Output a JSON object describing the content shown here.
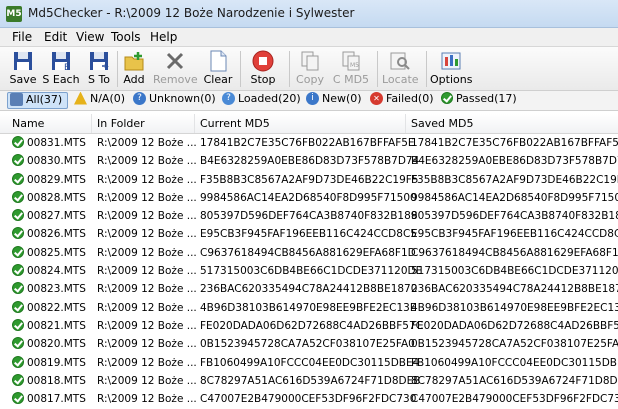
{
  "window": {
    "title": "Md5Checker - R:\\2009 12 Boże Narodzenie i Sylwester"
  },
  "menu": [
    "File",
    "Edit",
    "View",
    "Tools",
    "Help"
  ],
  "toolbar": {
    "save": "Save",
    "s_each": "S Each",
    "s_to": "S To",
    "add": "Add",
    "remove": "Remove",
    "clear": "Clear",
    "stop": "Stop",
    "copy": "Copy",
    "c_md5": "C MD5",
    "locate": "Locate",
    "options": "Options"
  },
  "filters": {
    "all": "All(37)",
    "na": "N/A(0)",
    "unknown": "Unknown(0)",
    "loaded": "Loaded(20)",
    "new": "New(0)",
    "failed": "Failed(0)",
    "passed": "Passed(17)"
  },
  "columns": {
    "name": "Name",
    "folder": "In Folder",
    "current": "Current MD5",
    "saved": "Saved MD5"
  },
  "rows": [
    {
      "name": "00831.MTS",
      "folder": "R:\\2009 12 Boże ...",
      "current": "17841B2C7E35C76FB022AB167BFFAF5E",
      "saved": "17841B2C7E35C76FB022AB167BFFAF5E"
    },
    {
      "name": "00830.MTS",
      "folder": "R:\\2009 12 Boże ...",
      "current": "B4E6328259A0EBE86D83D73F578B7D74",
      "saved": "B4E6328259A0EBE86D83D73F578B7D74"
    },
    {
      "name": "00829.MTS",
      "folder": "R:\\2009 12 Boże ...",
      "current": "F35B8B3C8567A2AF9D73DE46B22C19F5",
      "saved": "F35B8B3C8567A2AF9D73DE46B22C19F5"
    },
    {
      "name": "00828.MTS",
      "folder": "R:\\2009 12 Boże ...",
      "current": "9984586AC14EA2D68540F8D995F71500",
      "saved": "9984586AC14EA2D68540F8D995F71500"
    },
    {
      "name": "00827.MTS",
      "folder": "R:\\2009 12 Boże ...",
      "current": "805397D596DEF764CA3B8740F832B189",
      "saved": "805397D596DEF764CA3B8740F832B189"
    },
    {
      "name": "00826.MTS",
      "folder": "R:\\2009 12 Boże ...",
      "current": "E95CB3F945FAF196EEB116C424CCD8C5",
      "saved": "E95CB3F945FAF196EEB116C424CCD8C5"
    },
    {
      "name": "00825.MTS",
      "folder": "R:\\2009 12 Boże ...",
      "current": "C9637618494CB8456A881629EFA68F1D",
      "saved": "C9637618494CB8456A881629EFA68F1D"
    },
    {
      "name": "00824.MTS",
      "folder": "R:\\2009 12 Boże ...",
      "current": "517315003C6DB4BE66C1DCDE371120DE",
      "saved": "517315003C6DB4BE66C1DCDE371120DE"
    },
    {
      "name": "00823.MTS",
      "folder": "R:\\2009 12 Boże ...",
      "current": "236BAC620335494C78A24412B8BE1870",
      "saved": "236BAC620335494C78A24412B8BE1870"
    },
    {
      "name": "00822.MTS",
      "folder": "R:\\2009 12 Boże ...",
      "current": "4B96D38103B614970E98EE9BFE2EC13E",
      "saved": "4B96D38103B614970E98EE9BFE2EC13E"
    },
    {
      "name": "00821.MTS",
      "folder": "R:\\2009 12 Boże ...",
      "current": "FE020DADA06D62D72688C4AD26BBF57C",
      "saved": "FE020DADA06D62D72688C4AD26BBF57C"
    },
    {
      "name": "00820.MTS",
      "folder": "R:\\2009 12 Boże ...",
      "current": "0B1523945728CA7A52CF038107E25FA0",
      "saved": "0B1523945728CA7A52CF038107E25FA0"
    },
    {
      "name": "00819.MTS",
      "folder": "R:\\2009 12 Boże ...",
      "current": "FB1060499A10FCCC04EE0DC30115DBE4",
      "saved": "FB1060499A10FCCC04EE0DC30115DBE4"
    },
    {
      "name": "00818.MTS",
      "folder": "R:\\2009 12 Boże ...",
      "current": "8C78297A51AC616D539A6724F71D8DEB",
      "saved": "8C78297A51AC616D539A6724F71D8DEB"
    },
    {
      "name": "00817.MTS",
      "folder": "R:\\2009 12 Boże ...",
      "current": "C47007E2B479000CEF53DF96F2FDC730",
      "saved": "C47007E2B479000CEF53DF96F2FDC730"
    }
  ]
}
